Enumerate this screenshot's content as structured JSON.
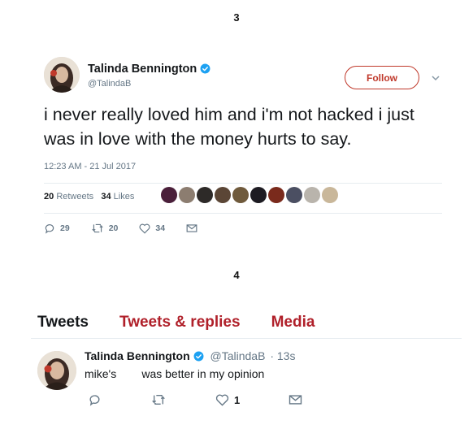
{
  "section_numbers": [
    "3",
    "4"
  ],
  "tweet_card": {
    "name": "Talinda Bennington",
    "handle": "@TalindaB",
    "follow_label": "Follow",
    "text": "i never really loved him and i'm not hacked i just was in love with the money hurts to say.",
    "timestamp": "12:23 AM - 21 Jul 2017",
    "retweets_count": "20",
    "retweets_label": "Retweets",
    "likes_count": "34",
    "likes_label": "Likes",
    "liker_colors": [
      "#4a1f3a",
      "#8c7d70",
      "#2d2a28",
      "#5b4636",
      "#6f5a3c",
      "#1d1b22",
      "#7a2a1c",
      "#4b4f62",
      "#b9b4ac",
      "#c9b79a"
    ],
    "reply_count": "29",
    "retweet_count": "20",
    "like_count": "34"
  },
  "profile_timeline": {
    "tabs": [
      "Tweets",
      "Tweets & replies",
      "Media"
    ],
    "tweet": {
      "name": "Talinda Bennington",
      "handle": "@TalindaB",
      "time": "· 13s",
      "text": "mike's        was better in my opinion",
      "like_count": "1"
    }
  },
  "colors": {
    "accent": "#b0202a",
    "verified": "#1da1f2",
    "muted": "#657786"
  }
}
